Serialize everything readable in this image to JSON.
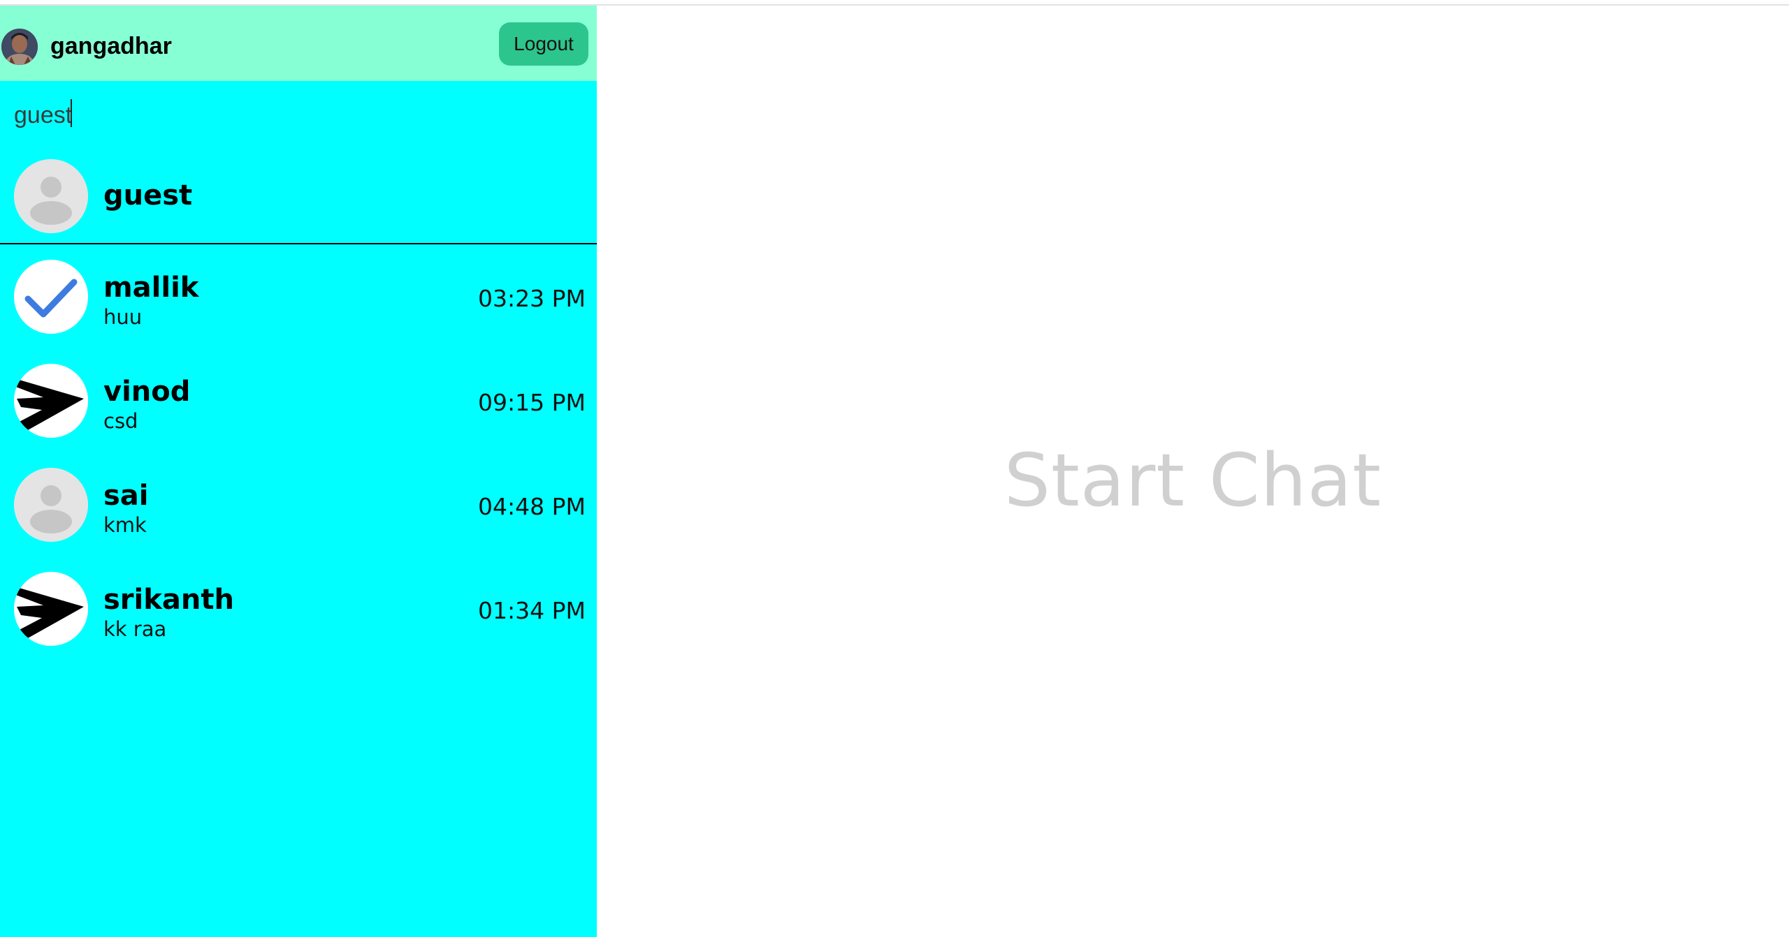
{
  "header": {
    "username": "gangadhar",
    "logout_label": "Logout",
    "avatar_icon": "profile-photo"
  },
  "search": {
    "value": "guest",
    "placeholder": ""
  },
  "search_results": [
    {
      "name": "guest",
      "avatar_icon": "default-user-icon"
    }
  ],
  "chats": [
    {
      "name": "mallik",
      "last_message": "huu",
      "time": "03:23 PM",
      "avatar_icon": "checkmark-icon"
    },
    {
      "name": "vinod",
      "last_message": "csd",
      "time": "09:15 PM",
      "avatar_icon": "arrow-icon"
    },
    {
      "name": "sai",
      "last_message": "kmk",
      "time": "04:48 PM",
      "avatar_icon": "default-user-icon"
    },
    {
      "name": "srikanth",
      "last_message": "kk raa",
      "time": "01:34 PM",
      "avatar_icon": "arrow-icon"
    }
  ],
  "main": {
    "placeholder_text": "Start Chat"
  },
  "colors": {
    "sidebar_bg": "#00ffff",
    "header_bg": "#87ffd5",
    "logout_bg": "#2cc58e",
    "placeholder_text": "#d0d0d0",
    "check_blue": "#3d7be0"
  }
}
